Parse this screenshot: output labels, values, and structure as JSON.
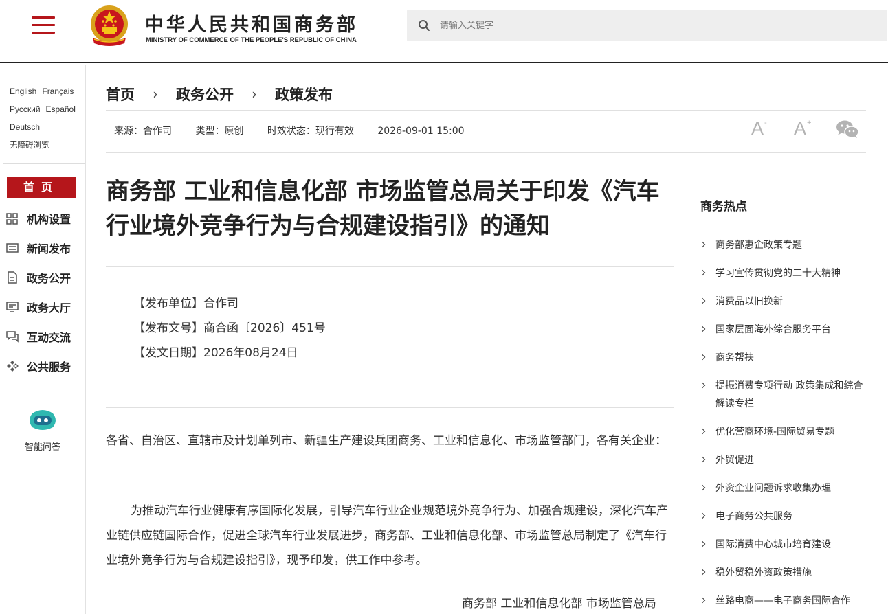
{
  "header": {
    "title_cn": "中华人民共和国商务部",
    "title_en": "MINISTRY OF COMMERCE OF THE PEOPLE'S REPUBLIC OF CHINA",
    "search_placeholder": "请输入关键字"
  },
  "sidebar": {
    "languages": [
      "English",
      "Français",
      "Русский",
      "Español",
      "Deutsch"
    ],
    "accessibility": "无障碍浏览",
    "home": "首页",
    "items": [
      {
        "label": "机构设置",
        "icon": "grid-icon"
      },
      {
        "label": "新闻发布",
        "icon": "news-icon"
      },
      {
        "label": "政务公开",
        "icon": "document-icon"
      },
      {
        "label": "政务大厅",
        "icon": "hall-icon"
      },
      {
        "label": "互动交流",
        "icon": "chat-icon"
      },
      {
        "label": "公共服务",
        "icon": "service-icon"
      }
    ],
    "assistant_label": "智能问答"
  },
  "breadcrumb": [
    "首页",
    "政务公开",
    "政策发布"
  ],
  "meta": {
    "source": "来源：合作司",
    "type": "类型：原创",
    "status": "时效状态：现行有效",
    "datetime": "2026-09-01 15:00"
  },
  "tools": {
    "font_decrease": "A",
    "font_increase": "A",
    "minus": "-",
    "plus": "+"
  },
  "article": {
    "title": "商务部 工业和信息化部 市场监管总局关于印发《汽车行业境外竞争行为与合规建设指引》的通知",
    "issuer": "【发布单位】合作司",
    "doc_no": "【发布文号】商合函〔2026〕451号",
    "date": "【发文日期】2026年08月24日",
    "salutation": "各省、自治区、直辖市及计划单列市、新疆生产建设兵团商务、工业和信息化、市场监管部门，各有关企业：",
    "paragraph": "为推动汽车行业健康有序国际化发展，引导汽车行业企业规范境外竞争行为、加强合规建设，深化汽车产业链供应链国际合作，促进全球汽车行业发展进步，商务部、工业和信息化部、市场监管总局制定了《汽车行业境外竞争行为与合规建设指引》，现予印发，供工作中参考。",
    "signature": "商务部 工业和信息化部 市场监管总局"
  },
  "hot": {
    "title": "商务热点",
    "items": [
      "商务部惠企政策专题",
      "学习宣传贯彻党的二十大精神",
      "消费品以旧换新",
      "国家层面海外综合服务平台",
      "商务帮扶",
      "提振消费专项行动 政策集成和综合解读专栏",
      "优化营商环境-国际贸易专题",
      "外贸促进",
      "外资企业问题诉求收集办理",
      "电子商务公共服务",
      "国际消费中心城市培育建设",
      "稳外贸稳外资政策措施",
      "丝路电商——电子商务国际合作"
    ]
  },
  "colors": {
    "brand_red": "#b5161b",
    "text": "#222222",
    "search_bg": "#eeeeee",
    "tool_gray": "#b3b3b3"
  }
}
